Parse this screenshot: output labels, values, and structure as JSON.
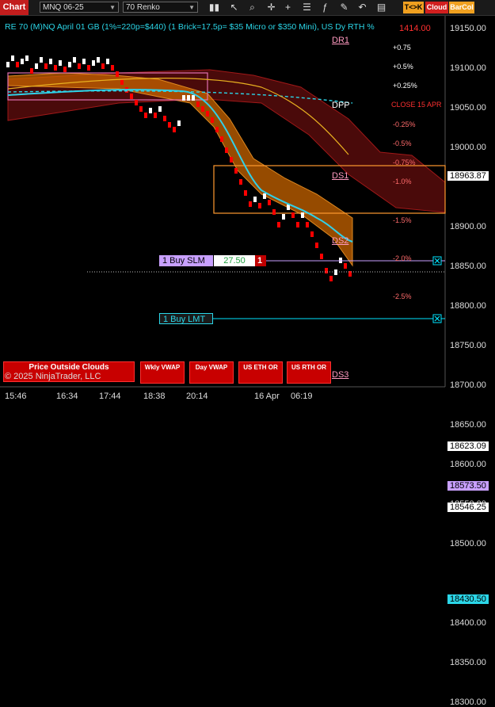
{
  "toolbar": {
    "title": "Chart",
    "instrument": "MNQ 06-25",
    "bar_type": "70 Renko",
    "buttons": [
      "T<>K",
      "Cloud",
      "BarCol"
    ],
    "icons": [
      "bars-icon",
      "cursor-icon",
      "zoom-icon",
      "crosshair-icon",
      "plus-icon",
      "strategy-icon",
      "indicator-icon",
      "drawing-icon",
      "undo-icon",
      "properties-icon"
    ]
  },
  "info_line": "RE 70 (M)NQ April 01 GB (1%=220p=$440) (1 Brick=17.5p= $35 Micro or $350 Mini), US Dy RTH %",
  "corner_price": "1414.00",
  "levels": {
    "dr1": "DR1",
    "dpp": "DPP",
    "ds1": "DS1",
    "ds2": "DS2",
    "ds3": "DS3",
    "close_label": "CLOSE 15 APR"
  },
  "percents": [
    "+0.75",
    "+0.5%",
    "+0.25%",
    "-0.25%",
    "-0.5%",
    "-0.75%",
    "-1.0%",
    "-1.5%",
    "-2.0%",
    "-2.5%"
  ],
  "y_axis": [
    "19150.00",
    "19100.00",
    "19050.00",
    "19000.00",
    "18963.87",
    "18900.00",
    "18850.00",
    "18800.00",
    "18750.00",
    "18700.00",
    "18650.00",
    "18623.09",
    "18600.00",
    "18573.50",
    "18550.00",
    "18546.25",
    "18500.00",
    "18430.50",
    "18400.00",
    "18350.00",
    "18300.00"
  ],
  "x_axis": [
    "15:46",
    "16:34",
    "17:44",
    "18:38",
    "20:14",
    "16 Apr",
    "06:19"
  ],
  "orders": {
    "buy_slm": "1 Buy SLM",
    "buy_slm_price": "27.50",
    "buy_slm_qty": "1",
    "buy_lmt": "1 Buy LMT",
    "close_x": "X"
  },
  "bottom_panels": [
    "Price Outside Clouds",
    "Wkly VWAP",
    "Day VWAP",
    "US ETH OR",
    "US RTH OR"
  ],
  "copyright": "© 2025 NinjaTrader, LLC",
  "colors": {
    "bear_brick": "#ff0000",
    "bull_brick": "#ffffff",
    "cloud_orange": "#c86400",
    "cloud_red": "#4a0a0a",
    "cyan_ma": "#30d0e8",
    "order_line": "#00e5ff"
  }
}
